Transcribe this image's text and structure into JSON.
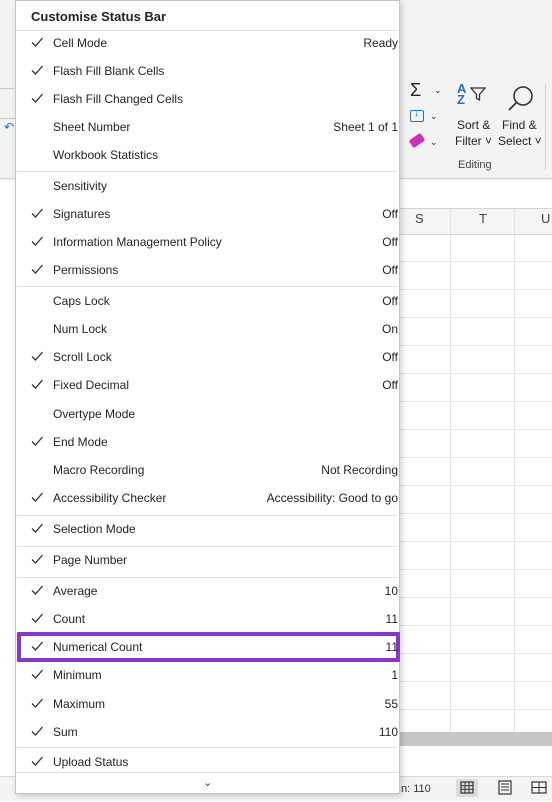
{
  "menu": {
    "title": "Customise Status Bar",
    "more_icon": "chevron-down-icon",
    "items": [
      {
        "label": "Cell Mode",
        "value": "Ready",
        "checked": true
      },
      {
        "label": "Flash Fill Blank Cells",
        "value": "",
        "checked": true
      },
      {
        "label": "Flash Fill Changed Cells",
        "value": "",
        "checked": true
      },
      {
        "label": "Sheet Number",
        "value": "Sheet 1 of 1",
        "checked": false
      },
      {
        "label": "Workbook Statistics",
        "value": "",
        "checked": false
      },
      {
        "label": "Sensitivity",
        "value": "",
        "checked": false
      },
      {
        "label": "Signatures",
        "value": "Off",
        "checked": true
      },
      {
        "label": "Information Management Policy",
        "value": "Off",
        "checked": true
      },
      {
        "label": "Permissions",
        "value": "Off",
        "checked": true
      },
      {
        "label": "Caps Lock",
        "value": "Off",
        "checked": false
      },
      {
        "label": "Num Lock",
        "value": "On",
        "checked": false
      },
      {
        "label": "Scroll Lock",
        "value": "Off",
        "checked": true
      },
      {
        "label": "Fixed Decimal",
        "value": "Off",
        "checked": true
      },
      {
        "label": "Overtype Mode",
        "value": "",
        "checked": false
      },
      {
        "label": "End Mode",
        "value": "",
        "checked": true
      },
      {
        "label": "Macro Recording",
        "value": "Not Recording",
        "checked": false
      },
      {
        "label": "Accessibility Checker",
        "value": "Accessibility: Good to go",
        "checked": true
      },
      {
        "label": "Selection Mode",
        "value": "",
        "checked": true
      },
      {
        "label": "Page Number",
        "value": "",
        "checked": true
      },
      {
        "label": "Average",
        "value": "10",
        "checked": true
      },
      {
        "label": "Count",
        "value": "11",
        "checked": true
      },
      {
        "label": "Numerical Count",
        "value": "11",
        "checked": true,
        "highlighted": true
      },
      {
        "label": "Minimum",
        "value": "1",
        "checked": true
      },
      {
        "label": "Maximum",
        "value": "55",
        "checked": true
      },
      {
        "label": "Sum",
        "value": "110",
        "checked": true
      },
      {
        "label": "Upload Status",
        "value": "",
        "checked": true
      }
    ]
  },
  "ribbon": {
    "sort_filter_line1": "Sort &",
    "sort_filter_line2": "Filter ˅",
    "find_select_line1": "Find &",
    "find_select_line2": "Select ˅",
    "group_label": "Editing",
    "az_label": "A\nZ",
    "autosum_icon": "sigma-icon",
    "fill_icon": "fill-down-icon",
    "clear_icon": "eraser-icon"
  },
  "grid": {
    "columns": [
      "S",
      "T",
      "U"
    ]
  },
  "status_bar": {
    "sum_text": "n: 110"
  },
  "colors": {
    "highlight": "#8a35c9",
    "accent": "#1e73c8"
  }
}
